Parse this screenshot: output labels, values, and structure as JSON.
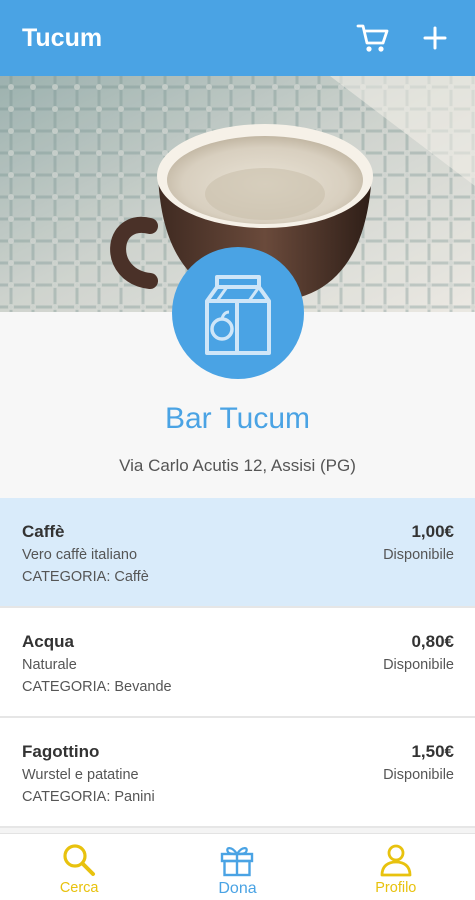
{
  "appbar": {
    "title": "Tucum",
    "actions": [
      {
        "icon": "cart-icon"
      },
      {
        "icon": "plus-icon"
      }
    ]
  },
  "shop": {
    "hero_image": "espresso-cup-photo",
    "logo_icon": "milk-carton-apple-icon",
    "name": "Bar Tucum",
    "address": "Via Carlo Acutis 12, Assisi (PG)"
  },
  "products": [
    {
      "name": "Caffè",
      "description": "Vero caffè italiano",
      "category": "CATEGORIA: Caffè",
      "price": "1,00€",
      "availability": "Disponibile",
      "selected": true
    },
    {
      "name": "Acqua",
      "description": "Naturale",
      "category": "CATEGORIA: Bevande",
      "price": "0,80€",
      "availability": "Disponibile",
      "selected": false
    },
    {
      "name": "Fagottino",
      "description": "Wurstel e patatine",
      "category": "CATEGORIA: Panini",
      "price": "1,50€",
      "availability": "Disponibile",
      "selected": false
    }
  ],
  "bottom_nav": [
    {
      "label": "Cerca",
      "icon": "search-icon",
      "color": "#e8c20e"
    },
    {
      "label": "Dona",
      "icon": "gift-icon",
      "color": "#4aa3e4"
    },
    {
      "label": "Profilo",
      "icon": "user-icon",
      "color": "#e8c20e"
    }
  ],
  "colors": {
    "primary": "#4aa3e4",
    "accent": "#e8c20e",
    "selected_row": "#d9ebfa"
  }
}
